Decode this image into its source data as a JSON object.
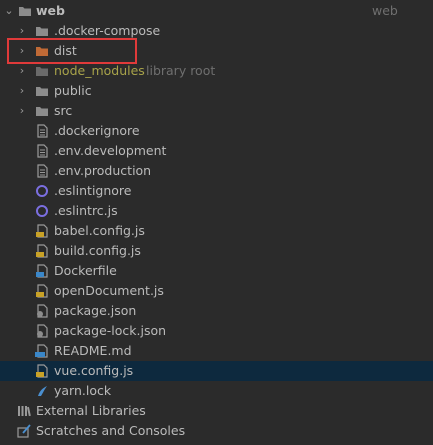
{
  "root": {
    "name": "web",
    "hint": "web"
  },
  "items": [
    {
      "name": ".docker-compose",
      "type": "folder"
    },
    {
      "name": "dist",
      "type": "folder-dist"
    },
    {
      "name": "node_modules",
      "hint": "library root",
      "type": "folder-excluded"
    },
    {
      "name": "public",
      "type": "folder"
    },
    {
      "name": "src",
      "type": "folder"
    },
    {
      "name": ".dockerignore",
      "type": "file-text"
    },
    {
      "name": ".env.development",
      "type": "file-text"
    },
    {
      "name": ".env.production",
      "type": "file-text"
    },
    {
      "name": ".eslintignore",
      "type": "file-eslint"
    },
    {
      "name": ".eslintrc.js",
      "type": "file-eslint"
    },
    {
      "name": "babel.config.js",
      "type": "file-js"
    },
    {
      "name": "build.config.js",
      "type": "file-js"
    },
    {
      "name": "Dockerfile",
      "type": "file-docker"
    },
    {
      "name": "openDocument.js",
      "type": "file-js"
    },
    {
      "name": "package.json",
      "type": "file-json"
    },
    {
      "name": "package-lock.json",
      "type": "file-json"
    },
    {
      "name": "README.md",
      "type": "file-md"
    },
    {
      "name": "vue.config.js",
      "type": "file-js"
    },
    {
      "name": "yarn.lock",
      "type": "file-yarn"
    }
  ],
  "external_libraries": "External Libraries",
  "scratches": "Scratches and Consoles",
  "colors": {
    "background": "#2b2b2b",
    "selection": "#0d293e",
    "folder": "#8c8c8c",
    "dist_folder": "#c06a36",
    "excluded_label": "#a8a34a",
    "highlight": "#e03a3a"
  }
}
